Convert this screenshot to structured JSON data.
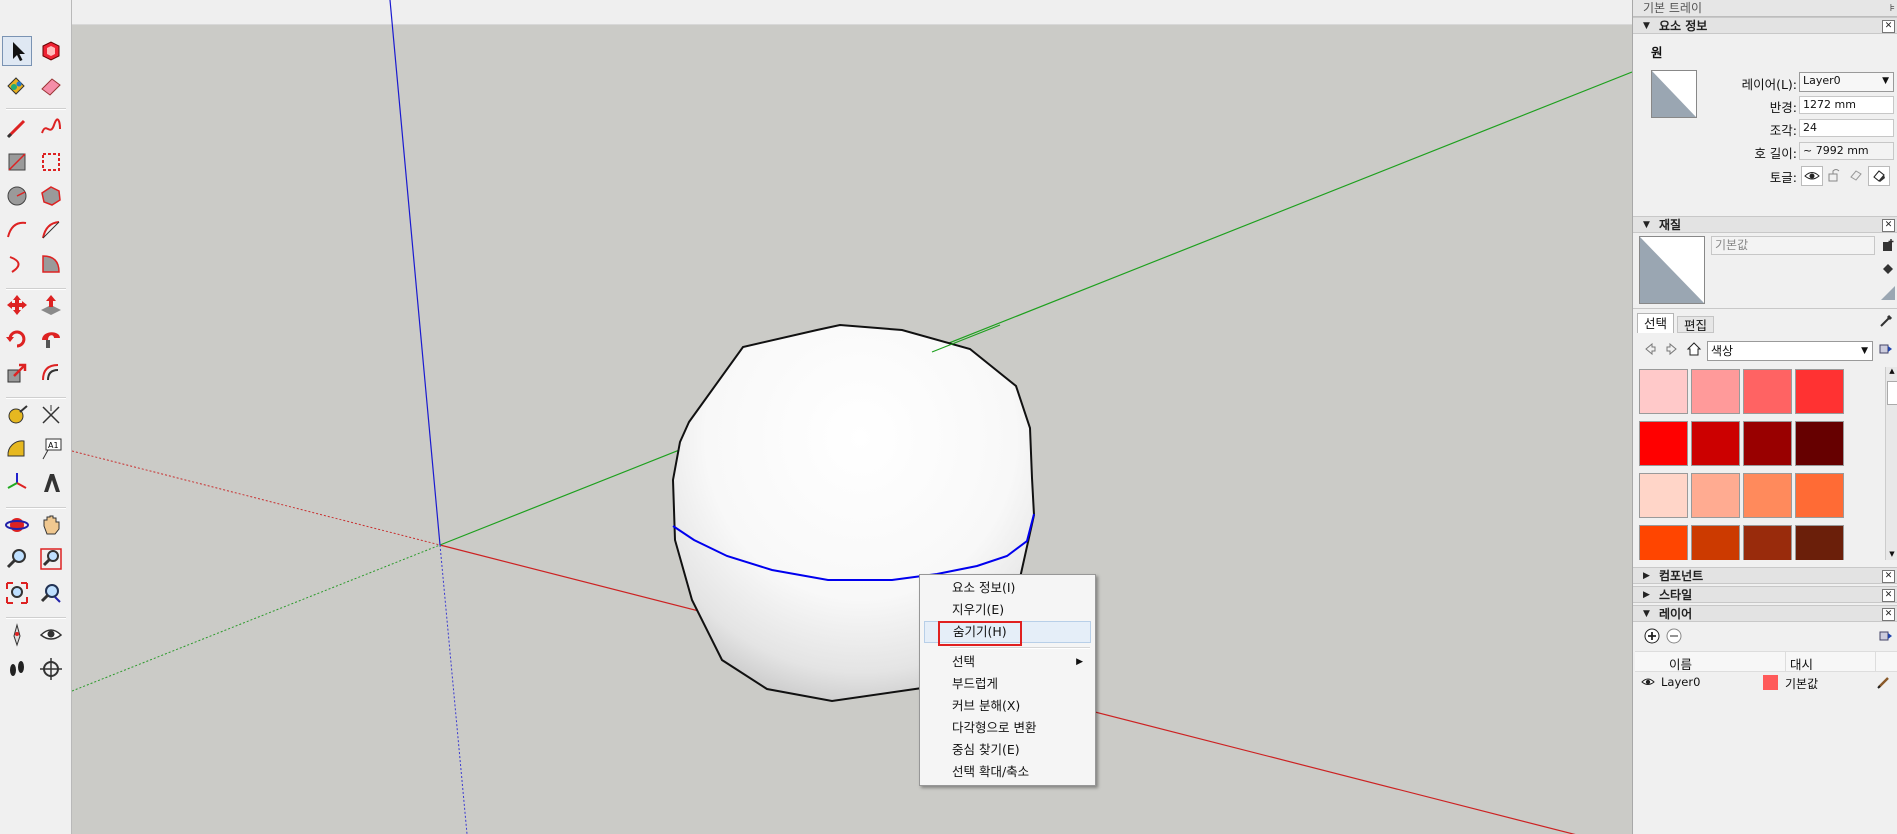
{
  "tray": {
    "title": "기본 트레이",
    "entity_info": {
      "header": "요소 정보",
      "type": "원",
      "layer_label": "레이어(L):",
      "layer_value": "Layer0",
      "radius_label": "반경:",
      "radius_value": "1272 mm",
      "segments_label": "조각:",
      "segments_value": "24",
      "arc_length_label": "호 길이:",
      "arc_length_value": "~ 7992 mm",
      "toggles_label": "토글:"
    },
    "materials": {
      "header": "재질",
      "name_placeholder": "기본값",
      "tab_select": "선택",
      "tab_edit": "편집",
      "library": "색상",
      "swatches": [
        "#ffc9c9",
        "#ff9a9a",
        "#ff6363",
        "#ff3232",
        "#ff0000",
        "#cc0000",
        "#990000",
        "#660000",
        "#ffd5c8",
        "#ffab91",
        "#ff8a5c",
        "#ff6b35",
        "#ff4500",
        "#cc3a00",
        "#992b0c",
        "#6b1f0a"
      ]
    },
    "components_header": "컴포넌트",
    "styles_header": "스타일",
    "layers": {
      "header": "레이어",
      "col_name": "이름",
      "col_color": "대시",
      "rows": [
        {
          "name": "Layer0",
          "color": "#ff5a5a",
          "dash": "기본값"
        }
      ]
    }
  },
  "context_menu": {
    "items": [
      {
        "label": "요소 정보(I)"
      },
      {
        "label": "지우기(E)"
      },
      {
        "label": "숨기기(H)",
        "highlighted": true
      },
      {
        "label": "선택",
        "submenu": true
      },
      {
        "label": "부드럽게"
      },
      {
        "label": "커브 분해(X)"
      },
      {
        "label": "다각형으로 변환"
      },
      {
        "label": "중심 찾기(E)"
      },
      {
        "label": "선택 확대/축소"
      }
    ]
  },
  "toolbar": {
    "tools": [
      "select-tool",
      "component-tool",
      "paint-bucket-tool",
      "eraser-tool",
      "line-tool",
      "freehand-tool",
      "rectangle-tool",
      "rotated-rectangle-tool",
      "circle-tool",
      "polygon-tool",
      "arc-tool",
      "pie-tool",
      "two-point-arc-tool",
      "three-point-arc-tool",
      "move-tool",
      "push-pull-tool",
      "rotate-tool",
      "follow-me-tool",
      "scale-tool",
      "offset-tool",
      "tape-measure-tool",
      "dimension-tool",
      "protractor-tool",
      "text-tool",
      "axes-tool",
      "3d-text-tool",
      "orbit-tool",
      "pan-tool",
      "zoom-tool",
      "zoom-window-tool",
      "zoom-extents-tool",
      "previous-view-tool",
      "position-camera-tool",
      "look-around-tool",
      "walk-tool",
      "section-plane-tool"
    ]
  },
  "colors": {
    "blue_axis": "#0000cc",
    "red_axis": "#cc0000",
    "green_axis": "#00a000",
    "selection": "#0000ee",
    "highlight_box": "#e02020"
  }
}
